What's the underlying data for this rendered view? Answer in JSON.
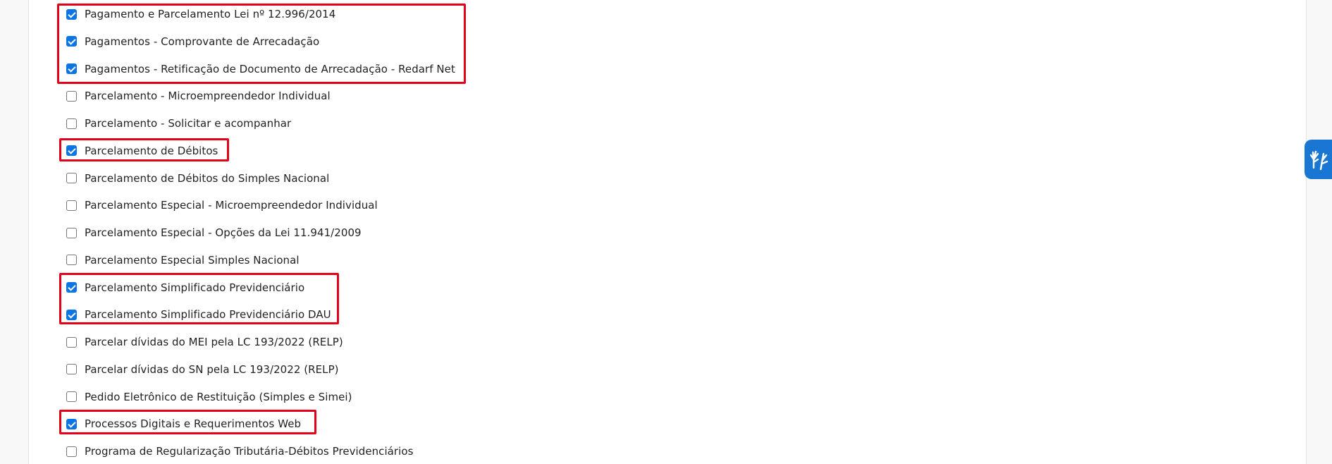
{
  "services": [
    {
      "label": "Pagamento e Parcelamento Lei nº 12.996/2014",
      "checked": true
    },
    {
      "label": "Pagamentos - Comprovante de Arrecadação",
      "checked": true
    },
    {
      "label": "Pagamentos - Retificação de Documento de Arrecadação - Redarf Net",
      "checked": true
    },
    {
      "label": "Parcelamento - Microempreendedor Individual",
      "checked": false
    },
    {
      "label": "Parcelamento - Solicitar e acompanhar",
      "checked": false
    },
    {
      "label": "Parcelamento de Débitos",
      "checked": true
    },
    {
      "label": "Parcelamento de Débitos do Simples Nacional",
      "checked": false
    },
    {
      "label": "Parcelamento Especial - Microempreendedor Individual",
      "checked": false
    },
    {
      "label": "Parcelamento Especial - Opções da Lei 11.941/2009",
      "checked": false
    },
    {
      "label": "Parcelamento Especial Simples Nacional",
      "checked": false
    },
    {
      "label": "Parcelamento Simplificado Previdenciário",
      "checked": true
    },
    {
      "label": "Parcelamento Simplificado Previdenciário DAU",
      "checked": true
    },
    {
      "label": "Parcelar dívidas do MEI pela LC 193/2022 (RELP)",
      "checked": false
    },
    {
      "label": "Parcelar dívidas do SN pela LC 193/2022 (RELP)",
      "checked": false
    },
    {
      "label": "Pedido Eletrônico de Restituição (Simples e Simei)",
      "checked": false
    },
    {
      "label": "Processos Digitais e Requerimentos Web",
      "checked": true
    },
    {
      "label": "Programa de Regularização Tributária-Débitos Previdenciários",
      "checked": false
    }
  ],
  "colors": {
    "checkbox_checked": "#0b75e6",
    "highlight": "#e3001b",
    "accessibility_widget": "#1976d2"
  },
  "accessibility_widget": {
    "icon": "sign-language-hands-icon"
  }
}
